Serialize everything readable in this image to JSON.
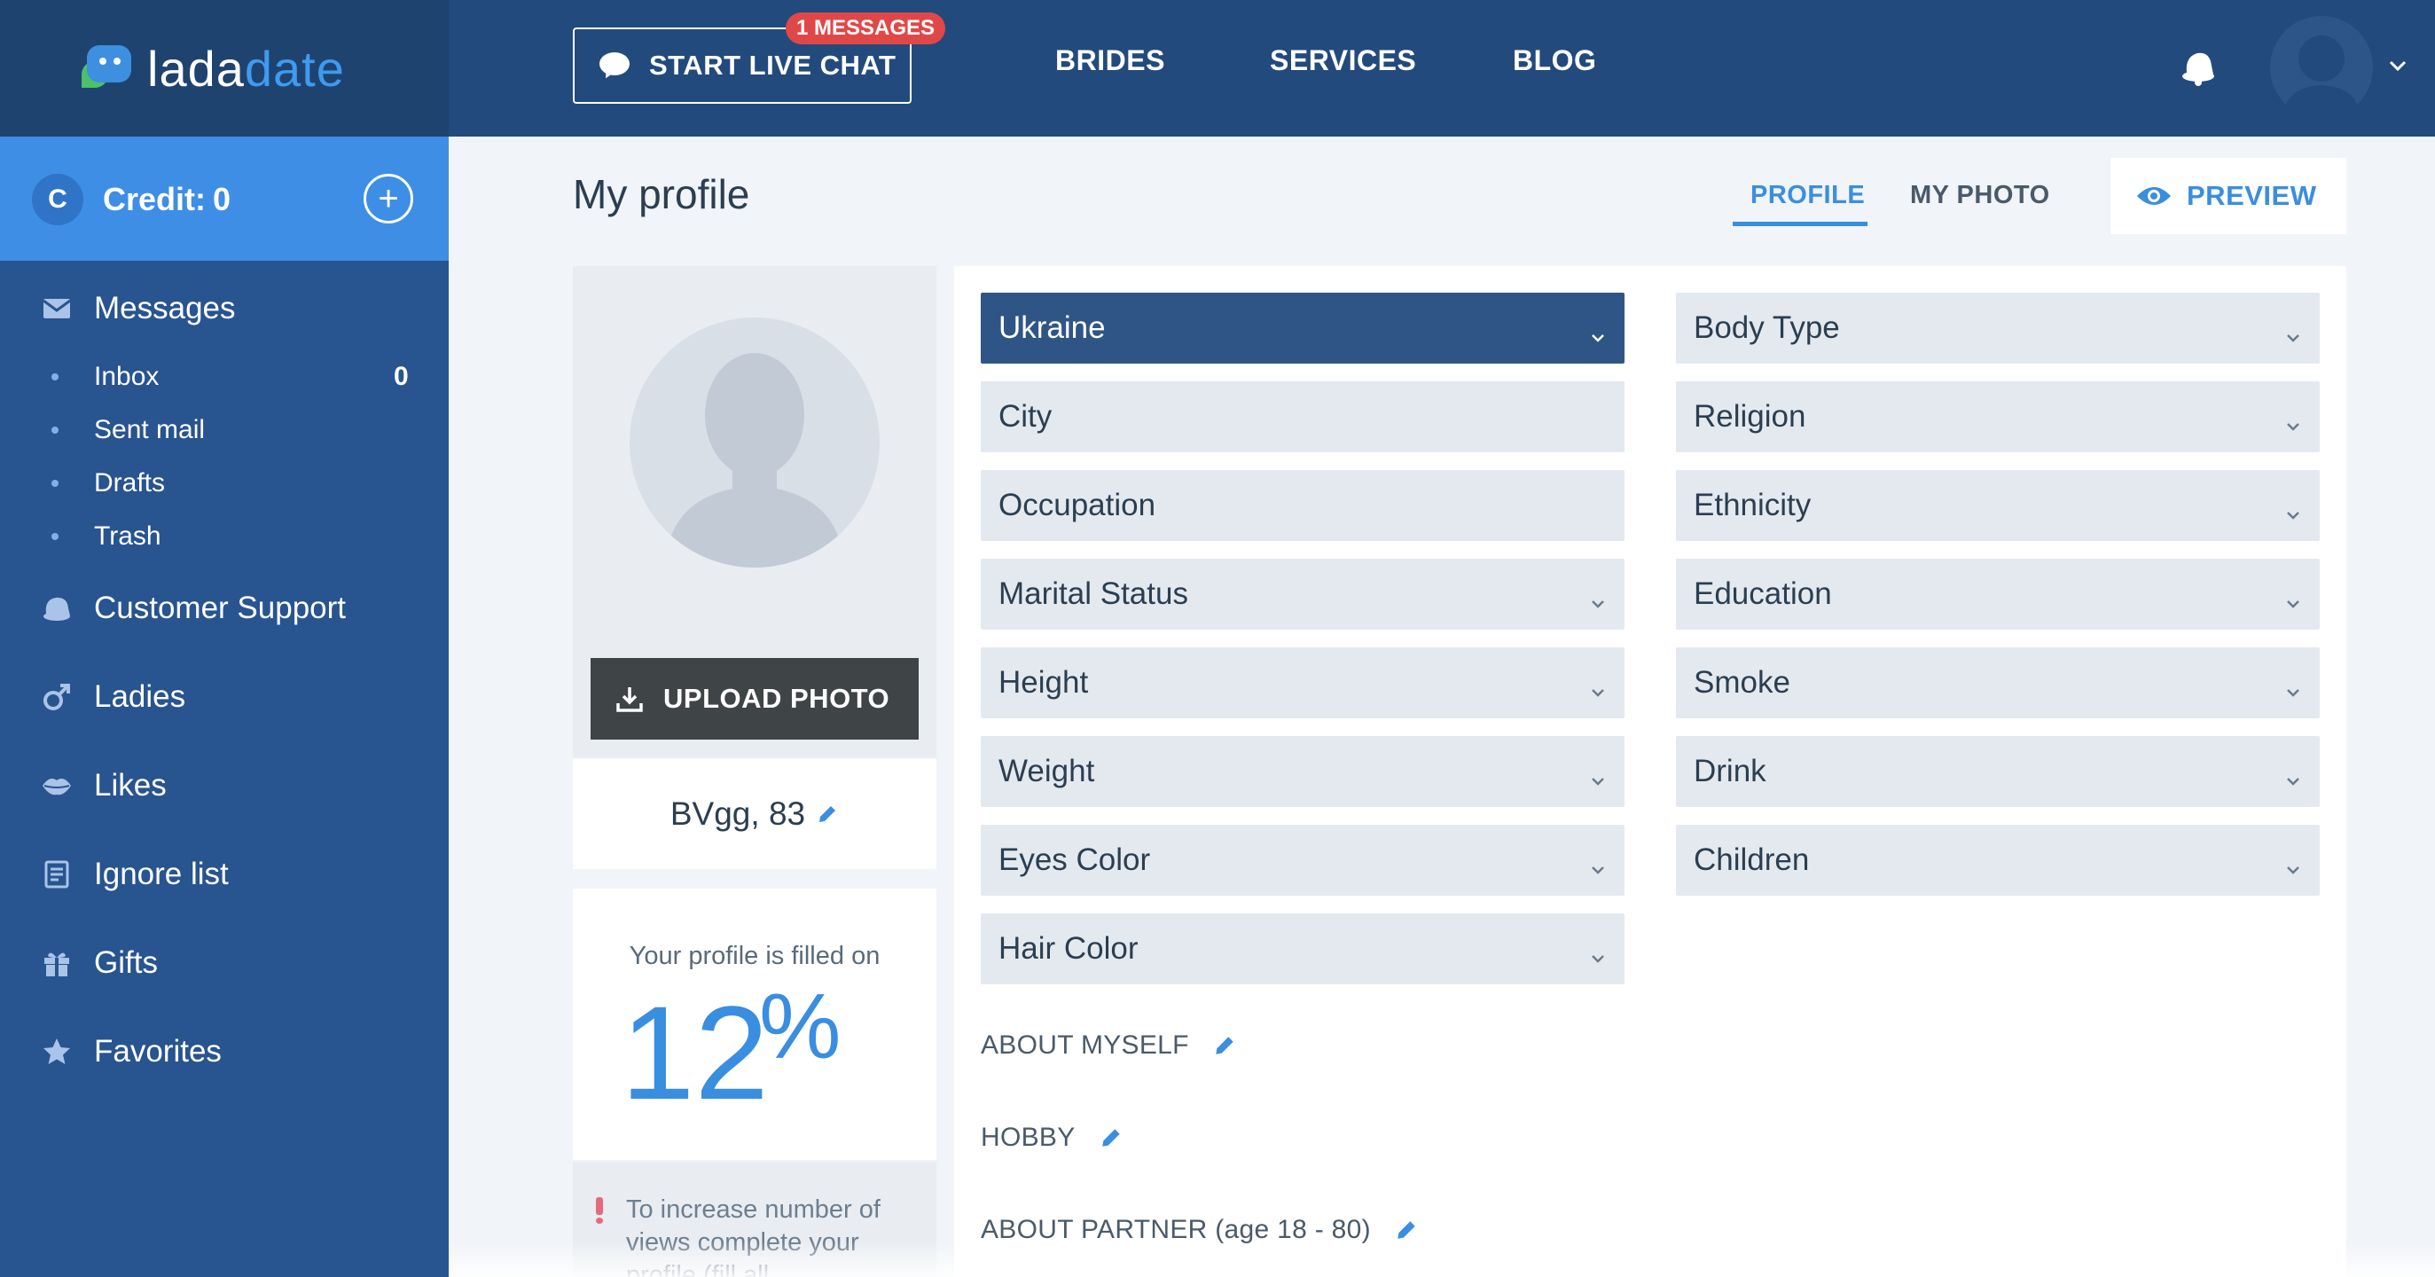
{
  "header": {
    "logo_part1": "lada",
    "logo_part2": "date",
    "chat_button": "START LIVE CHAT",
    "messages_badge": "1 MESSAGES",
    "nav": [
      "BRIDES",
      "SERVICES",
      "BLOG"
    ]
  },
  "sidebar": {
    "credit_label": "Credit:",
    "credit_value": "0",
    "credit_icon_letter": "C",
    "messages": "Messages",
    "sub": [
      {
        "label": "Inbox",
        "count": "0"
      },
      {
        "label": "Sent mail"
      },
      {
        "label": "Drafts"
      },
      {
        "label": "Trash"
      }
    ],
    "items": [
      "Customer Support",
      "Ladies",
      "Likes",
      "Ignore list",
      "Gifts",
      "Favorites"
    ]
  },
  "main": {
    "title": "My profile",
    "tabs": [
      "PROFILE",
      "MY PHOTO"
    ],
    "preview": "PREVIEW",
    "upload": "UPLOAD PHOTO",
    "name_age": "BVgg, 83",
    "fill_label": "Your profile is filled on",
    "fill_value": "12",
    "fill_unit": "%",
    "fill_fraction": 0.12,
    "tip": "To increase number of views complete your profile (fill all"
  },
  "form": {
    "left": [
      {
        "label": "Ukraine",
        "dropdown": true
      },
      {
        "label": "City",
        "dropdown": false
      },
      {
        "label": "Occupation",
        "dropdown": false
      },
      {
        "label": "Marital Status",
        "dropdown": true
      },
      {
        "label": "Height",
        "dropdown": true
      },
      {
        "label": "Weight",
        "dropdown": true
      },
      {
        "label": "Eyes Color",
        "dropdown": true
      },
      {
        "label": "Hair Color",
        "dropdown": true
      }
    ],
    "right": [
      {
        "label": "Body Type",
        "dropdown": true
      },
      {
        "label": "Religion",
        "dropdown": true
      },
      {
        "label": "Ethnicity",
        "dropdown": true
      },
      {
        "label": "Education",
        "dropdown": true
      },
      {
        "label": "Smoke",
        "dropdown": true
      },
      {
        "label": "Drink",
        "dropdown": true
      },
      {
        "label": "Children",
        "dropdown": true
      }
    ],
    "sections": [
      "ABOUT MYSELF",
      "HOBBY",
      "ABOUT PARTNER (age 18 - 80)"
    ]
  },
  "colors": {
    "topbar": "#234a7c",
    "sidebar": "#285490",
    "credit": "#3e8ee6",
    "accent": "#3a8ee0",
    "selected_field": "#2f5586"
  }
}
